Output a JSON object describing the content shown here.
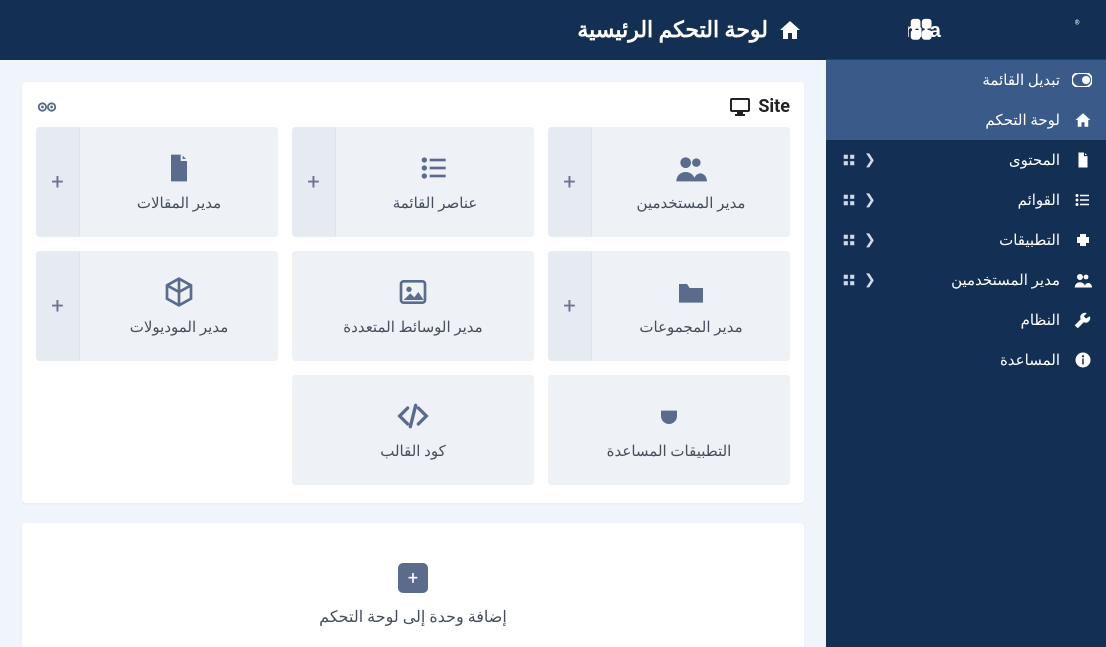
{
  "brand": {
    "name": "Joomla!"
  },
  "toggle": {
    "label": "تبديل القائمة"
  },
  "nav": [
    {
      "key": "dashboard",
      "label": "لوحة التحكم",
      "icon": "home",
      "sub": false,
      "active": true
    },
    {
      "key": "content",
      "label": "المحتوى",
      "icon": "file",
      "sub": true
    },
    {
      "key": "menus",
      "label": "القوائم",
      "icon": "list",
      "sub": true
    },
    {
      "key": "components",
      "label": "التطبيقات",
      "icon": "puzzle",
      "sub": true
    },
    {
      "key": "users",
      "label": "مدير المستخدمين",
      "icon": "users",
      "sub": true
    },
    {
      "key": "system",
      "label": "النظام",
      "icon": "wrench",
      "sub": false
    },
    {
      "key": "help",
      "label": "المساعدة",
      "icon": "info",
      "sub": false
    }
  ],
  "page_title": "لوحة التحكم الرئيسية",
  "panel_title": "Site",
  "tiles": [
    {
      "label": "مدير المستخدمين",
      "icon": "users",
      "plus": true
    },
    {
      "label": "عناصر القائمة",
      "icon": "list",
      "plus": true
    },
    {
      "label": "مدير المقالات",
      "icon": "file",
      "plus": true
    },
    {
      "label": "مدير المجموعات",
      "icon": "folder",
      "plus": true
    },
    {
      "label": "مدير الوسائط المتعددة",
      "icon": "image",
      "plus": false
    },
    {
      "label": "مدير الموديولات",
      "icon": "cube",
      "plus": true
    },
    {
      "label": "التطبيقات المساعدة",
      "icon": "plug",
      "plus": false
    },
    {
      "label": "كود القالب",
      "icon": "code",
      "plus": false
    }
  ],
  "add_module": {
    "label": "إضافة وحدة إلى لوحة التحكم"
  }
}
